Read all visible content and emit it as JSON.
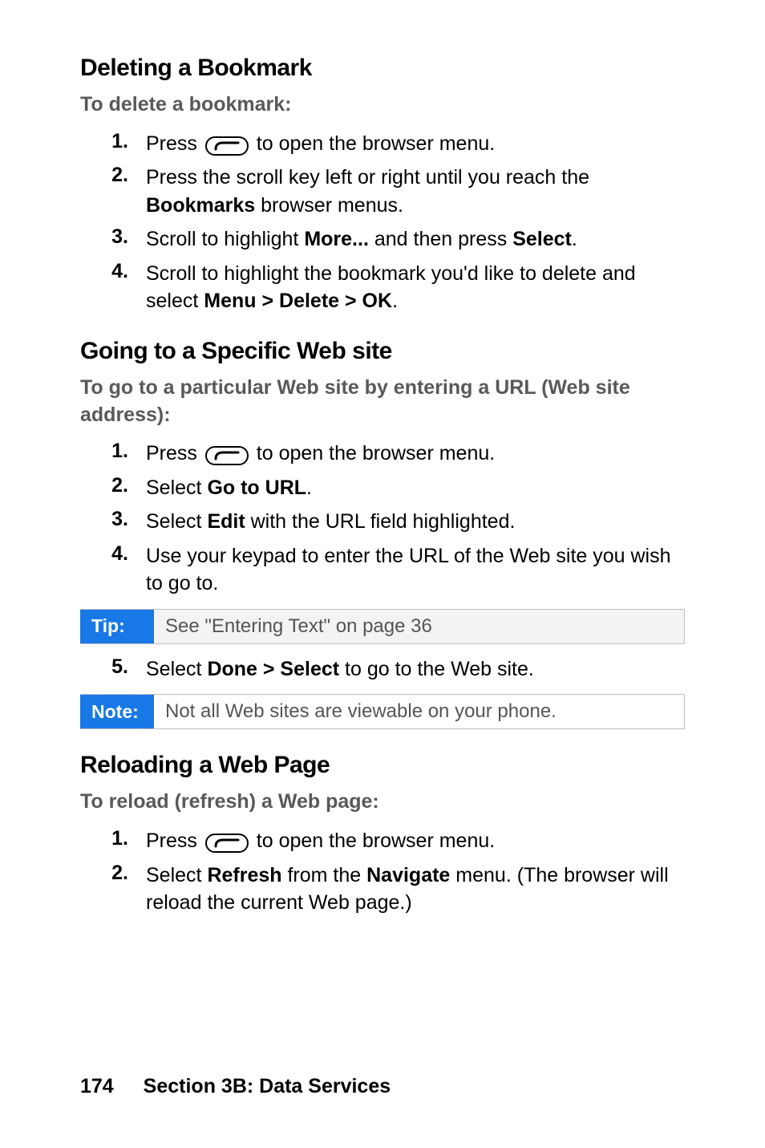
{
  "section1": {
    "heading": "Deleting a Bookmark",
    "subhead": "To delete a bookmark:",
    "steps": [
      {
        "num": "1.",
        "pre": "Press ",
        "post": " to open the browser menu."
      },
      {
        "num": "2.",
        "html": "Press the scroll key left or right until you reach the <b>Bookmarks</b> browser menus."
      },
      {
        "num": "3.",
        "html": "Scroll to highlight <b>More...</b> and then press <b>Select</b>."
      },
      {
        "num": "4.",
        "html": "Scroll to highlight the bookmark you'd like to delete and select <b>Menu > Delete > OK</b>."
      }
    ]
  },
  "section2": {
    "heading": "Going to a Specific Web site",
    "subhead": "To go to a particular Web site by entering a URL (Web site address):",
    "steps_a": [
      {
        "num": "1.",
        "pre": "Press ",
        "post": " to open the browser menu."
      },
      {
        "num": "2.",
        "html": "Select <b>Go to URL</b>."
      },
      {
        "num": "3.",
        "html": "Select <b>Edit</b> with the URL field highlighted."
      },
      {
        "num": "4.",
        "html": "Use your keypad to enter the URL of the Web site you wish to go to."
      }
    ],
    "tip_label": "Tip:",
    "tip_body": "See \"Entering Text\" on page 36",
    "steps_b": [
      {
        "num": "5.",
        "html": "Select <b>Done > Select</b> to go to the Web site."
      }
    ],
    "note_label": "Note:",
    "note_body": "Not all Web sites are viewable on your phone."
  },
  "section3": {
    "heading": "Reloading a Web Page",
    "subhead": "To reload (refresh) a Web page:",
    "steps": [
      {
        "num": "1.",
        "pre": "Press ",
        "post": " to open the browser menu."
      },
      {
        "num": "2.",
        "html": "Select <b>Refresh</b> from the <b>Navigate</b> menu. (The browser will reload the current Web page.)"
      }
    ]
  },
  "footer": {
    "page": "174",
    "section": "Section 3B: Data Services"
  }
}
